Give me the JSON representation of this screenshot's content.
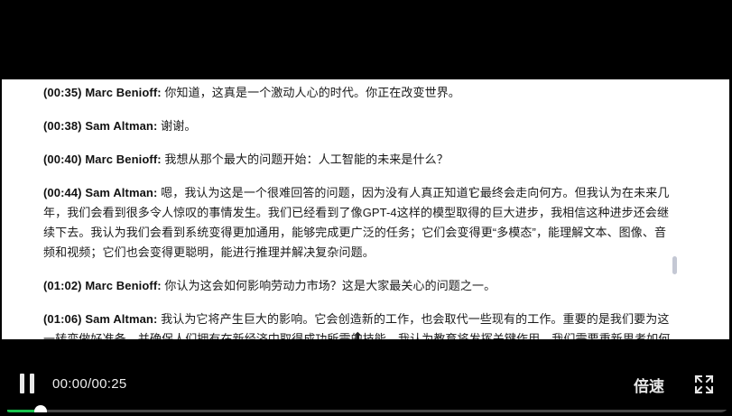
{
  "transcript": [
    {
      "timestamp": "(00:35)",
      "speaker": "Marc Benioff:",
      "text": " 你知道，这真是一个激动人心的时代。你正在改变世界。"
    },
    {
      "timestamp": "(00:38)",
      "speaker": "Sam Altman:",
      "text": " 谢谢。"
    },
    {
      "timestamp": "(00:40)",
      "speaker": "Marc Benioff:",
      "text": " 我想从那个最大的问题开始：人工智能的未来是什么？"
    },
    {
      "timestamp": "(00:44)",
      "speaker": "Sam Altman:",
      "text": " 嗯，我认为这是一个很难回答的问题，因为没有人真正知道它最终会走向何方。但我认为在未来几年，我们会看到很多令人惊叹的事情发生。我们已经看到了像GPT-4这样的模型取得的巨大进步，我相信这种进步还会继续下去。我认为我们会看到系统变得更加通用，能够完成更广泛的任务；它们会变得更“多模态”，能理解文本、图像、音频和视频；它们也会变得更聪明，能进行推理并解决复杂问题。"
    },
    {
      "timestamp": "(01:02)",
      "speaker": "Marc Benioff:",
      "text": " 你认为这会如何影响劳动力市场？这是大家最关心的问题之一。"
    },
    {
      "timestamp": "(01:06)",
      "speaker": "Sam Altman:",
      "text": " 我认为它将产生巨大的影响。它会创造新的工作，也会取代一些现有的工作。重要的是我们要为这一转变做好准备，并确保人们拥有在新经济中取得成功所需的技能。我认为教育将发挥关键作用，我们需要重新思考如何教"
    }
  ],
  "player": {
    "time_display": "00:00/00:25",
    "speed_label": "倍速",
    "progress_fraction": 0.047
  },
  "icons": {
    "pause": "pause-icon",
    "fullscreen": "fullscreen-icon"
  },
  "colors": {
    "progress_accent": "#19c24e"
  }
}
